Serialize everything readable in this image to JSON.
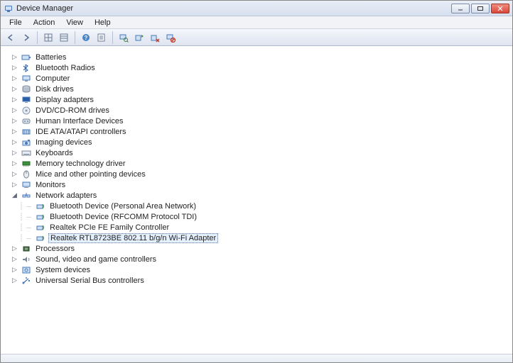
{
  "window": {
    "title": "Device Manager"
  },
  "menu": {
    "items": [
      "File",
      "Action",
      "View",
      "Help"
    ]
  },
  "toolbar": {
    "items": [
      {
        "name": "back",
        "glyph": "arrow-left"
      },
      {
        "name": "forward",
        "glyph": "arrow-right"
      },
      {
        "sep": true
      },
      {
        "name": "show-hidden",
        "glyph": "grid-a"
      },
      {
        "name": "grid-b",
        "glyph": "grid-b"
      },
      {
        "sep": true
      },
      {
        "name": "help",
        "glyph": "help"
      },
      {
        "name": "properties",
        "glyph": "props"
      },
      {
        "sep": true
      },
      {
        "name": "scan-hardware",
        "glyph": "scan"
      },
      {
        "name": "update-driver",
        "glyph": "update"
      },
      {
        "name": "uninstall",
        "glyph": "uninstall"
      },
      {
        "name": "disable",
        "glyph": "disable"
      }
    ]
  },
  "tree": [
    {
      "label": "Batteries",
      "icon": "battery",
      "exp": "closed",
      "depth": 1
    },
    {
      "label": "Bluetooth Radios",
      "icon": "bluetooth",
      "exp": "closed",
      "depth": 1
    },
    {
      "label": "Computer",
      "icon": "computer",
      "exp": "closed",
      "depth": 1
    },
    {
      "label": "Disk drives",
      "icon": "disk",
      "exp": "closed",
      "depth": 1
    },
    {
      "label": "Display adapters",
      "icon": "display",
      "exp": "closed",
      "depth": 1
    },
    {
      "label": "DVD/CD-ROM drives",
      "icon": "optical",
      "exp": "closed",
      "depth": 1
    },
    {
      "label": "Human Interface Devices",
      "icon": "hid",
      "exp": "closed",
      "depth": 1
    },
    {
      "label": "IDE ATA/ATAPI controllers",
      "icon": "ide",
      "exp": "closed",
      "depth": 1
    },
    {
      "label": "Imaging devices",
      "icon": "imaging",
      "exp": "closed",
      "depth": 1
    },
    {
      "label": "Keyboards",
      "icon": "keyboard",
      "exp": "closed",
      "depth": 1
    },
    {
      "label": "Memory technology driver",
      "icon": "memory",
      "exp": "closed",
      "depth": 1
    },
    {
      "label": "Mice and other pointing devices",
      "icon": "mouse",
      "exp": "closed",
      "depth": 1
    },
    {
      "label": "Monitors",
      "icon": "monitor",
      "exp": "closed",
      "depth": 1
    },
    {
      "label": "Network adapters",
      "icon": "network",
      "exp": "open",
      "depth": 1
    },
    {
      "label": "Bluetooth Device (Personal Area Network)",
      "icon": "net-device",
      "exp": "none",
      "depth": 2
    },
    {
      "label": "Bluetooth Device (RFCOMM Protocol TDI)",
      "icon": "net-device",
      "exp": "none",
      "depth": 2
    },
    {
      "label": "Realtek PCIe FE Family Controller",
      "icon": "net-device",
      "exp": "none",
      "depth": 2
    },
    {
      "label": "Realtek RTL8723BE 802.11 b/g/n Wi-Fi Adapter",
      "icon": "net-device",
      "exp": "none",
      "depth": 2,
      "selected": true
    },
    {
      "label": "Processors",
      "icon": "cpu",
      "exp": "closed",
      "depth": 1
    },
    {
      "label": "Sound, video and game controllers",
      "icon": "sound",
      "exp": "closed",
      "depth": 1
    },
    {
      "label": "System devices",
      "icon": "system",
      "exp": "closed",
      "depth": 1
    },
    {
      "label": "Universal Serial Bus controllers",
      "icon": "usb",
      "exp": "closed",
      "depth": 1
    }
  ]
}
